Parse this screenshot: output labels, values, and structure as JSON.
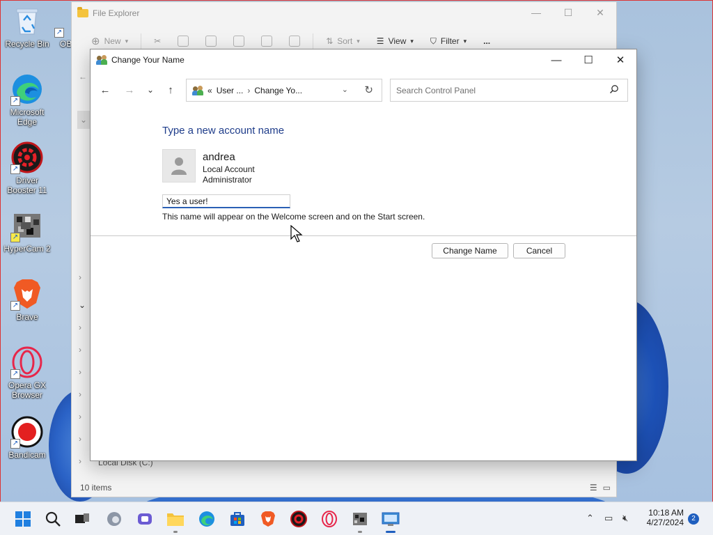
{
  "desktop": {
    "icons": [
      {
        "label": "Recycle Bin"
      },
      {
        "label": "OB"
      },
      {
        "label": "Microsoft Edge"
      },
      {
        "label": "Driver Booster 11"
      },
      {
        "label": "HyperCam 2"
      },
      {
        "label": "Brave"
      },
      {
        "label": "Opera GX Browser"
      },
      {
        "label": "Bandicam"
      }
    ]
  },
  "explorer": {
    "title": "File Explorer",
    "toolbar": {
      "new_label": "New",
      "sort_label": "Sort",
      "view_label": "View",
      "filter_label": "Filter",
      "more_label": "..."
    },
    "local_disk_label": "Local Disk (C:)",
    "status_items": "10 items"
  },
  "dialog": {
    "title": "Change Your Name",
    "breadcrumb": {
      "prefix": "«",
      "crumb1": "User ...",
      "crumb2": "Change Yo..."
    },
    "search_placeholder": "Search Control Panel",
    "heading": "Type a new account name",
    "account": {
      "name": "andrea",
      "type": "Local Account",
      "role": "Administrator"
    },
    "name_input_value": "Yes a user!",
    "hint": "This name will appear on the Welcome screen and on the Start screen.",
    "buttons": {
      "change_name": "Change Name",
      "cancel": "Cancel"
    }
  },
  "taskbar": {
    "clock_time": "10:18 AM",
    "clock_date": "4/27/2024",
    "notification_count": "2"
  },
  "colors": {
    "heading_blue": "#1e3c8a",
    "accent": "#1f5fbf"
  }
}
